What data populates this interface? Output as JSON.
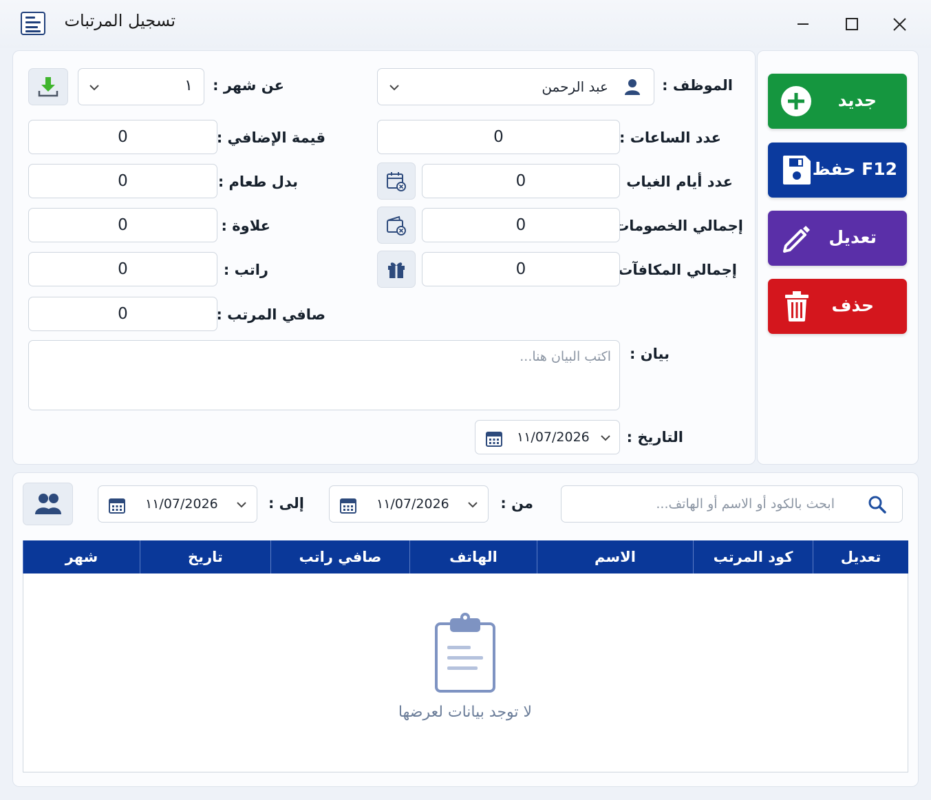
{
  "window": {
    "title": "تسجيل المرتبات",
    "minimize_icon": "minimize-icon",
    "maximize_icon": "maximize-icon",
    "close_icon": "close-icon"
  },
  "form": {
    "employee_label": "الموظف :",
    "employee_value": "عبد الرحمن",
    "month_label": "عن شهر :",
    "month_value": "١",
    "hours_label": "عدد الساعات :",
    "hours_value": "0",
    "overtime_label": "قيمة الإضافي :",
    "overtime_value": "0",
    "absence_label": "عدد أيام الغياب :",
    "absence_value": "0",
    "food_label": "بدل طعام :",
    "food_value": "0",
    "deductions_label": "إجمالي الخصومات :",
    "deductions_value": "0",
    "bonus_label": "علاوة :",
    "bonus_value": "0",
    "rewards_label": "إجمالي المكافآت :",
    "rewards_value": "0",
    "salary_label": "راتب :",
    "salary_value": "0",
    "net_label": "صافي المرتب :",
    "net_value": "0",
    "notes_label": "بيان :",
    "notes_placeholder": "اكتب البيان هنا...",
    "date_label": "التاريخ :",
    "date_value": "١١/07/2026"
  },
  "actions": {
    "new_label": "جديد",
    "save_label": "F12  حفظ",
    "edit_label": "تعديل",
    "delete_label": "حذف"
  },
  "filter": {
    "search_placeholder": "ابحث بالكود أو الاسم أو الهاتف...",
    "from_label": "من :",
    "from_date": "١١/07/2026",
    "to_label": "إلى :",
    "to_date": "١١/07/2026"
  },
  "table": {
    "columns": [
      "تعديل",
      "كود المرتب",
      "الاسم",
      "الهاتف",
      "صافي راتب",
      "تاريخ",
      "شهر"
    ],
    "empty_text": "لا توجد بيانات لعرضها"
  },
  "colors": {
    "new": "#15963f",
    "save": "#0b3a9e",
    "edit": "#5a2fa8",
    "delete": "#d4161d",
    "header": "#0a3899"
  }
}
